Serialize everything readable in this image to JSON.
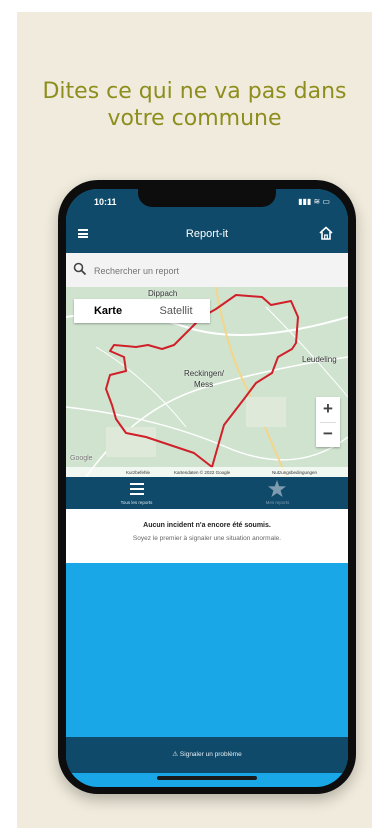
{
  "promo": {
    "headline_line1": "Dites ce qui ne va pas dans",
    "headline_line2": "votre commune"
  },
  "status_bar": {
    "time": "10:11",
    "signal": "▮▮▮ ≋ ▭"
  },
  "app_bar": {
    "title": "Report-it",
    "menu_icon": "hamburger-icon",
    "home_icon": "home-icon"
  },
  "search": {
    "placeholder": "Rechercher un report",
    "icon": "search-icon"
  },
  "map": {
    "map_type_options": [
      "Karte",
      "Satellit"
    ],
    "selected_type": "Karte",
    "place_labels": [
      "Dippach",
      "Reckingen/",
      "Mess",
      "Leudeling"
    ],
    "zoom_in": "+",
    "zoom_out": "−",
    "attribution": [
      "Kurzbefehle",
      "Kartendaten © 2022 Google",
      "Nutzungsbedingungen"
    ],
    "google_logo": "Google",
    "boundary_color": "#d0202a"
  },
  "tabs": [
    {
      "label": "Tous les reports",
      "icon": "list-icon"
    },
    {
      "label": "Mes reports",
      "icon": "star-icon"
    }
  ],
  "empty_state": {
    "line1": "Aucun incident n'a encore été soumis.",
    "line2": "Soyez le premier à signaler une situation anormale."
  },
  "report_button": {
    "label": "Signaler un problème",
    "icon": "alert-icon"
  },
  "colors": {
    "primary": "#0f4a6a",
    "accent": "#1aa7e8",
    "background": "#f0ebdc",
    "headline": "#8e8e1e"
  }
}
